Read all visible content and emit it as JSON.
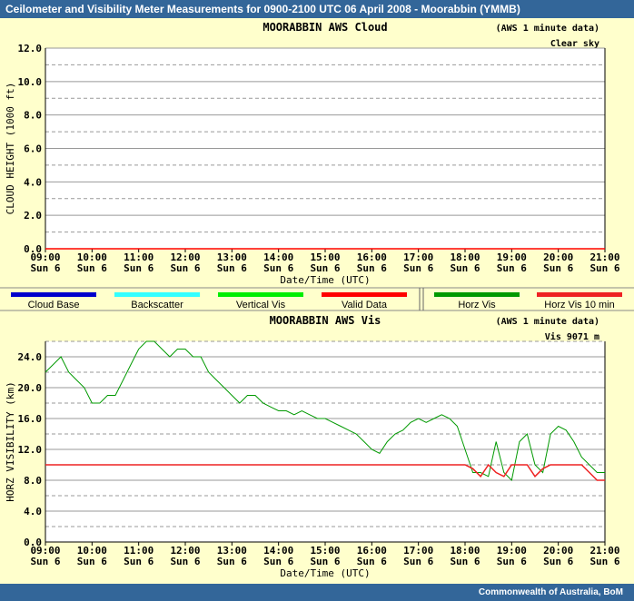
{
  "header": {
    "title": "Ceilometer and Visibility Meter Measurements for 0900-2100 UTC  06 April 2008 - Moorabbin (YMMB)"
  },
  "footer": {
    "credit": "Commonwealth of  Australia, BoM"
  },
  "colors": {
    "banner": "#336699",
    "background": "#ffffcc",
    "cloud_base": "#0000cc",
    "backscatter": "#33ffff",
    "vertical_vis": "#00ee00",
    "valid_data": "#ff0000",
    "horz_vis": "#009900",
    "horz_vis_10min": "#ee2222"
  },
  "legend": [
    {
      "label": "Cloud Base",
      "color": "#0000cc"
    },
    {
      "label": "Backscatter",
      "color": "#33ffff"
    },
    {
      "label": "Vertical Vis",
      "color": "#00ee00"
    },
    {
      "label": "Valid Data",
      "color": "#ff0000"
    },
    {
      "label": "Horz Vis",
      "color": "#009900"
    },
    {
      "label": "Horz Vis 10 min",
      "color": "#ee2222"
    }
  ],
  "chart_data": [
    {
      "type": "line",
      "title": "MOORABBIN AWS Cloud",
      "note": "(AWS 1 minute data)",
      "status": "Clear sky",
      "xlabel": "Date/Time (UTC)",
      "ylabel": "CLOUD HEIGHT (1000 ft)",
      "ylim": [
        0,
        12
      ],
      "xlim": [
        "09:00",
        "21:00"
      ],
      "yticks": [
        "0.0",
        "2.0",
        "4.0",
        "6.0",
        "8.0",
        "10.0",
        "12.0"
      ],
      "xticks": [
        {
          "time": "09:00",
          "day": "Sun 6"
        },
        {
          "time": "10:00",
          "day": "Sun 6"
        },
        {
          "time": "11:00",
          "day": "Sun 6"
        },
        {
          "time": "12:00",
          "day": "Sun 6"
        },
        {
          "time": "13:00",
          "day": "Sun 6"
        },
        {
          "time": "14:00",
          "day": "Sun 6"
        },
        {
          "time": "15:00",
          "day": "Sun 6"
        },
        {
          "time": "16:00",
          "day": "Sun 6"
        },
        {
          "time": "17:00",
          "day": "Sun 6"
        },
        {
          "time": "18:00",
          "day": "Sun 6"
        },
        {
          "time": "19:00",
          "day": "Sun 6"
        },
        {
          "time": "20:00",
          "day": "Sun 6"
        },
        {
          "time": "21:00",
          "day": "Sun 6"
        }
      ],
      "grid": true,
      "series": [
        {
          "color": "#ff0000",
          "x": [
            "09:00",
            "21:00"
          ],
          "values": [
            0,
            0
          ]
        }
      ]
    },
    {
      "type": "line",
      "title": "MOORABBIN AWS Vis",
      "note": "(AWS 1 minute data)",
      "status": "Vis 9071 m",
      "xlabel": "Date/Time (UTC)",
      "ylabel": "HORZ VISIBILITY (km)",
      "ylim": [
        0,
        26
      ],
      "xlim": [
        "09:00",
        "21:00"
      ],
      "yticks": [
        "0.0",
        "4.0",
        "8.0",
        "12.0",
        "16.0",
        "20.0",
        "24.0"
      ],
      "xticks": [
        {
          "time": "09:00",
          "day": "Sun 6"
        },
        {
          "time": "10:00",
          "day": "Sun 6"
        },
        {
          "time": "11:00",
          "day": "Sun 6"
        },
        {
          "time": "12:00",
          "day": "Sun 6"
        },
        {
          "time": "13:00",
          "day": "Sun 6"
        },
        {
          "time": "14:00",
          "day": "Sun 6"
        },
        {
          "time": "15:00",
          "day": "Sun 6"
        },
        {
          "time": "16:00",
          "day": "Sun 6"
        },
        {
          "time": "17:00",
          "day": "Sun 6"
        },
        {
          "time": "18:00",
          "day": "Sun 6"
        },
        {
          "time": "19:00",
          "day": "Sun 6"
        },
        {
          "time": "20:00",
          "day": "Sun 6"
        },
        {
          "time": "21:00",
          "day": "Sun 6"
        }
      ],
      "grid": true,
      "series": [
        {
          "color": "#009900",
          "x": [
            "09:00",
            "09:10",
            "09:20",
            "09:30",
            "09:40",
            "09:50",
            "10:00",
            "10:10",
            "10:20",
            "10:30",
            "10:40",
            "10:50",
            "11:00",
            "11:10",
            "11:20",
            "11:30",
            "11:40",
            "11:50",
            "12:00",
            "12:10",
            "12:20",
            "12:30",
            "12:40",
            "12:50",
            "13:00",
            "13:10",
            "13:20",
            "13:30",
            "13:40",
            "13:50",
            "14:00",
            "14:10",
            "14:20",
            "14:30",
            "14:40",
            "14:50",
            "15:00",
            "15:10",
            "15:20",
            "15:30",
            "15:40",
            "15:50",
            "16:00",
            "16:10",
            "16:20",
            "16:30",
            "16:40",
            "16:50",
            "17:00",
            "17:10",
            "17:20",
            "17:30",
            "17:40",
            "17:50",
            "18:00",
            "18:10",
            "18:20",
            "18:30",
            "18:40",
            "18:50",
            "19:00",
            "19:10",
            "19:20",
            "19:30",
            "19:40",
            "19:50",
            "20:00",
            "20:10",
            "20:20",
            "20:30",
            "20:40",
            "20:50",
            "21:00"
          ],
          "values": [
            22,
            23,
            24,
            22,
            21,
            20,
            18,
            18,
            19,
            19,
            21,
            23,
            25,
            26,
            26,
            25,
            24,
            25,
            25,
            24,
            24,
            22,
            21,
            20,
            19,
            18,
            19,
            19,
            18,
            17.5,
            17,
            17,
            16.5,
            17,
            16.5,
            16,
            16,
            15.5,
            15,
            14.5,
            14,
            13,
            12,
            11.5,
            13,
            14,
            14.5,
            15.5,
            16,
            15.5,
            16,
            16.5,
            16,
            15,
            12,
            9,
            9,
            8.5,
            13,
            9,
            8,
            13,
            14,
            10,
            9,
            14,
            15,
            14.5,
            13,
            11,
            10,
            9,
            9
          ]
        },
        {
          "color": "#ee2222",
          "x": [
            "09:00",
            "18:00",
            "18:10",
            "18:20",
            "18:30",
            "18:40",
            "18:50",
            "19:00",
            "19:10",
            "19:20",
            "19:30",
            "19:40",
            "19:50",
            "20:00",
            "20:10",
            "20:20",
            "20:30",
            "20:40",
            "20:50",
            "21:00"
          ],
          "values": [
            10,
            10,
            9.5,
            8.5,
            10,
            9,
            8.5,
            10,
            10,
            10,
            8.5,
            9.5,
            10,
            10,
            10,
            10,
            10,
            9,
            8,
            8
          ]
        }
      ]
    }
  ]
}
